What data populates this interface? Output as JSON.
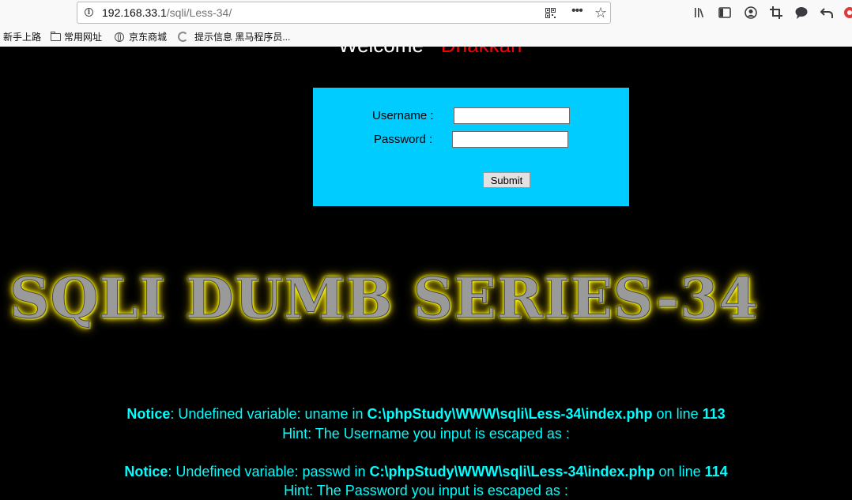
{
  "browser": {
    "url_host": "192.168.33.1",
    "url_path": "/sqli/Less-34/",
    "bookmarks": [
      "新手上路",
      "常用网址",
      "京东商城",
      "提示信息 黑马程序员..."
    ]
  },
  "page": {
    "welcome_text": "Welcome",
    "welcome_user": "Dhakkan",
    "form": {
      "username_label": "Username :",
      "password_label": "Password :",
      "username_value": "",
      "password_value": "",
      "submit_label": "Submit"
    },
    "banner": "SQLI DUMB SERIES-34",
    "notices": [
      {
        "prefix": "Notice",
        "text": ": Undefined variable: uname in ",
        "file": "C:\\phpStudy\\WWW\\sqli\\Less-34\\index.php",
        "line_text": " on line ",
        "line": "113",
        "hint": "Hint: The Username you input is escaped as :"
      },
      {
        "prefix": "Notice",
        "text": ": Undefined variable: passwd in ",
        "file": "C:\\phpStudy\\WWW\\sqli\\Less-34\\index.php",
        "line_text": " on line ",
        "line": "114",
        "hint": "Hint: The Password you input is escaped as :"
      }
    ]
  },
  "colors": {
    "background": "#000000",
    "form_bg": "#00ccff",
    "notice_text": "#00ffff",
    "welcome_user": "#ff0000",
    "banner_glow": "#ffff00"
  }
}
